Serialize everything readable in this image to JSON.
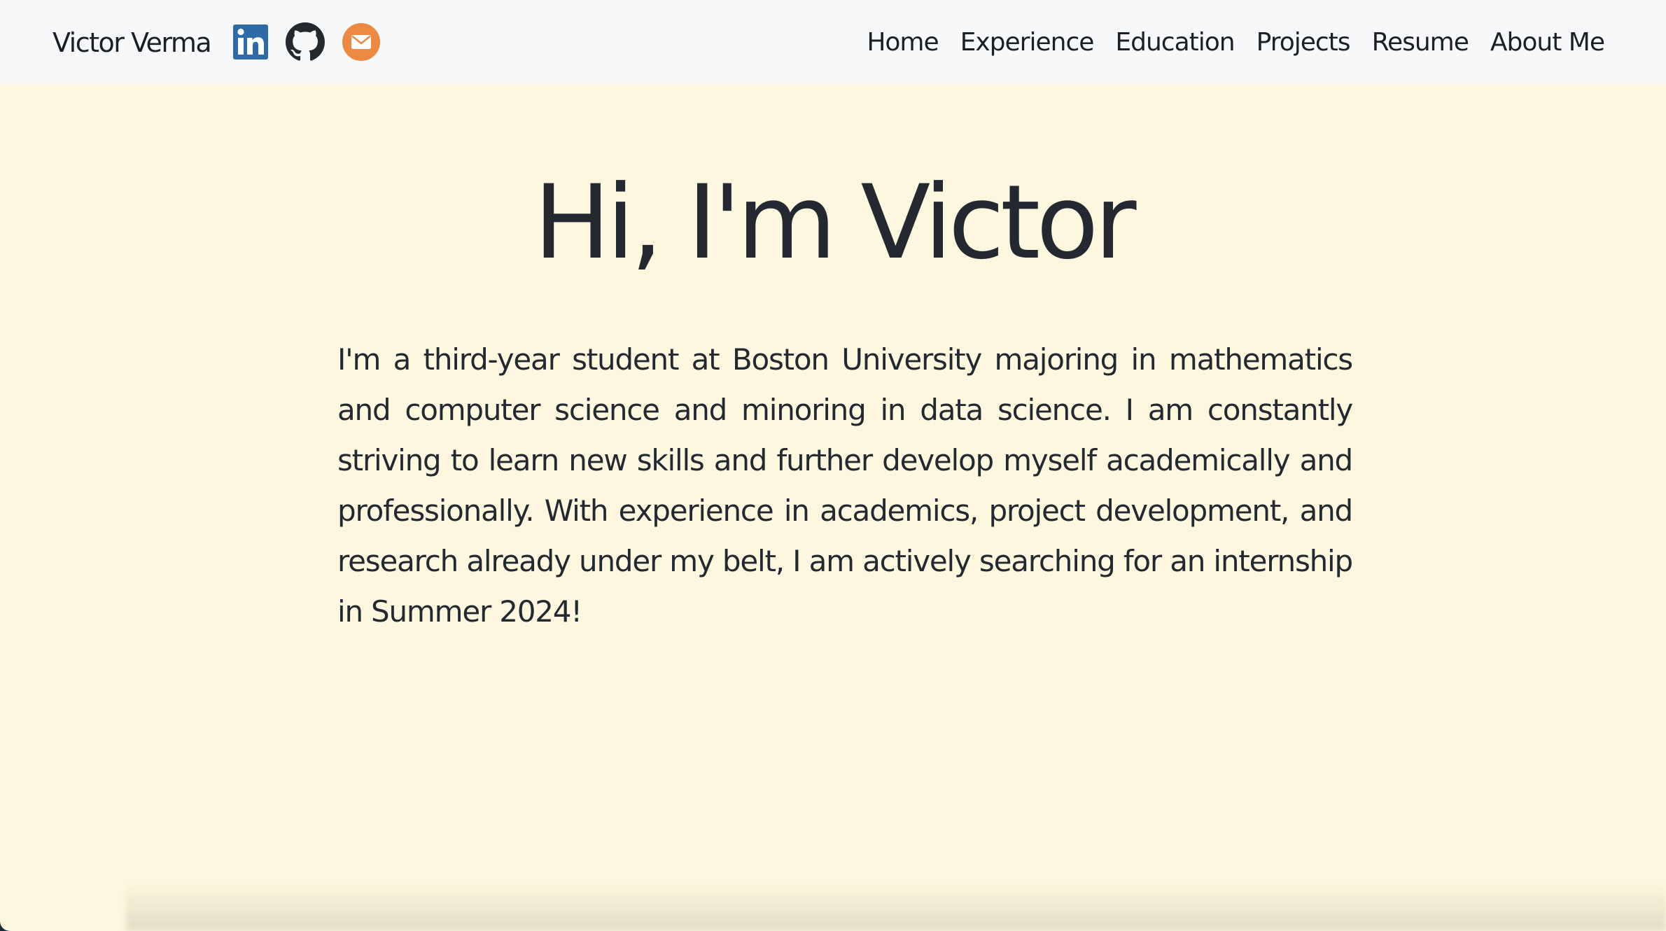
{
  "navbar": {
    "brand": "Victor Verma",
    "social": [
      {
        "icon": "linkedin-icon",
        "color": "#2e6aa8"
      },
      {
        "icon": "github-icon",
        "color": "#24292f"
      },
      {
        "icon": "email-icon",
        "color": "#ec8a43"
      }
    ],
    "links": [
      "Home",
      "Experience",
      "Education",
      "Projects",
      "Resume",
      "About Me"
    ]
  },
  "hero": {
    "title": "Hi, I'm Victor",
    "intro": "I'm a third-year student at Boston University majoring in mathematics and computer science and minoring in data science. I am constantly striving to learn new skills and further develop myself academically and professionally. With experience in academics, project development, and research already under my belt, I am actively searching for an internship in Summer 2024!"
  },
  "colors": {
    "page_background": "#fdf7df",
    "navbar_background": "#f7f8fa",
    "text": "#232831"
  }
}
